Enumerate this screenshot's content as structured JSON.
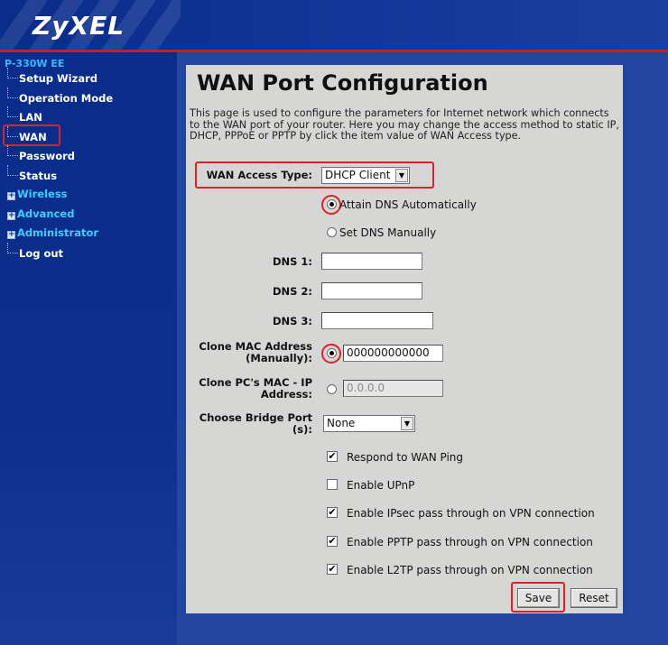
{
  "brand": {
    "logo": "ZyXEL"
  },
  "sidebar": {
    "model": "P-330W EE",
    "items": [
      {
        "label": "Setup Wizard"
      },
      {
        "label": "Operation Mode"
      },
      {
        "label": "LAN"
      },
      {
        "label": "WAN"
      },
      {
        "label": "Password"
      },
      {
        "label": "Status"
      },
      {
        "label": "Wireless"
      },
      {
        "label": "Advanced"
      },
      {
        "label": "Administrator"
      },
      {
        "label": "Log out"
      }
    ]
  },
  "page": {
    "title": "WAN Port Configuration",
    "description": "This page is used to configure the parameters for Internet network which connects to the WAN port of your router. Here you may change the access method to static IP, DHCP, PPPoE or PPTP by click the item value of WAN Access type."
  },
  "form": {
    "wan_access_type_label": "WAN Access Type:",
    "wan_access_type_value": "DHCP Client",
    "dns_auto_label": "Attain DNS Automatically",
    "dns_manual_label": "Set DNS Manually",
    "dns1_label": "DNS 1:",
    "dns1_value": "",
    "dns2_label": "DNS 2:",
    "dns2_value": "",
    "dns3_label": "DNS 3:",
    "dns3_value": "",
    "clone_mac_label_1": "Clone MAC Address",
    "clone_mac_label_2": "(Manually):",
    "clone_mac_value": "000000000000",
    "clone_pc_label_1": "Clone PC's MAC - IP",
    "clone_pc_label_2": "Address:",
    "clone_pc_value": "0.0.0.0",
    "bridge_label_1": "Choose Bridge Port",
    "bridge_label_2": "(s):",
    "bridge_value": "None",
    "checkboxes": [
      {
        "label": "Respond to WAN Ping",
        "checked": true
      },
      {
        "label": "Enable UPnP",
        "checked": false
      },
      {
        "label": "Enable IPsec pass through on VPN connection",
        "checked": true
      },
      {
        "label": "Enable PPTP pass through on VPN connection",
        "checked": true
      },
      {
        "label": "Enable L2TP pass through on VPN connection",
        "checked": true
      }
    ],
    "save_label": "Save",
    "reset_label": "Reset"
  },
  "colors": {
    "header_blue": "#12379a",
    "sidebar_blue": "#0a2c8a",
    "accent_red": "#d8232a",
    "panel_gray": "#d6d6d4"
  }
}
